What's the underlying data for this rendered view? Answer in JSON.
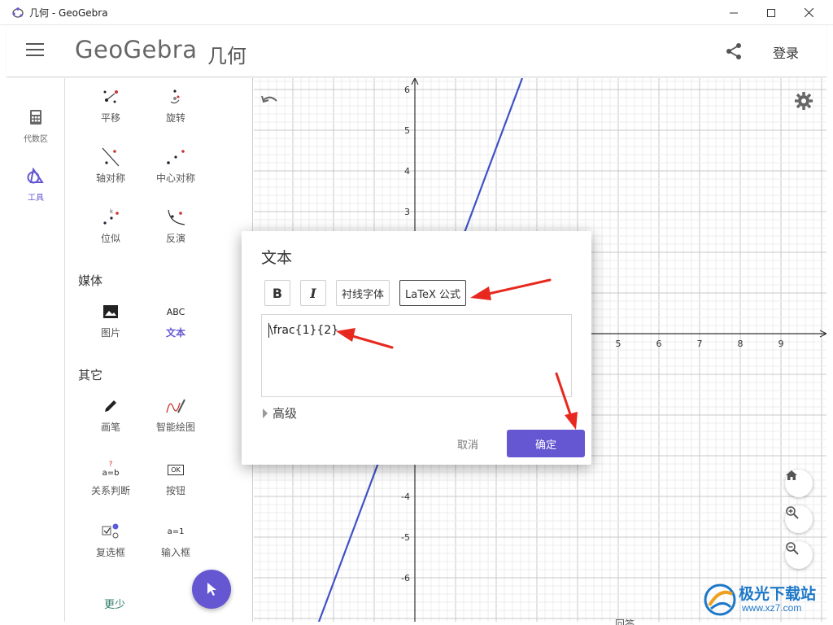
{
  "window": {
    "title": "几何 - GeoGebra"
  },
  "header": {
    "logo": "GeoGebra",
    "app_name": "几何",
    "login": "登录"
  },
  "rail": {
    "algebra": "代数区",
    "tools": "工具"
  },
  "tools": {
    "translate": "平移",
    "rotate": "旋转",
    "axis_reflect": "轴对称",
    "point_reflect": "中心对称",
    "dilate": "位似",
    "invert": "反演",
    "media_title": "媒体",
    "image": "图片",
    "abc": "ABC",
    "text": "文本",
    "other_title": "其它",
    "pen": "画笔",
    "freehand": "智能绘图",
    "relation_q": "?",
    "relation_eq": "a=b",
    "relation": "关系判断",
    "ok_icon": "OK",
    "button": "按钮",
    "checkbox": "复选框",
    "input_icon": "a=1",
    "input": "输入框",
    "more": "更少"
  },
  "graph": {
    "y_ticks": [
      "6",
      "5",
      "4",
      "3",
      "-4",
      "-5",
      "-6"
    ],
    "x_ticks": [
      "5",
      "6",
      "7",
      "8",
      "9"
    ],
    "line_color": "#3f51c8",
    "bottom_text": "回答"
  },
  "dialog": {
    "title": "文本",
    "bold": "B",
    "italic": "I",
    "serif": "衬线字体",
    "latex": "LaTeX 公式",
    "content": "\\frac{1}{2}",
    "advanced": "高级",
    "cancel": "取消",
    "ok": "确定"
  },
  "watermark": {
    "text": "极光下载站",
    "url": "www.xz7.com"
  },
  "colors": {
    "accent": "#6557d2",
    "annotation": "#e8281e"
  }
}
